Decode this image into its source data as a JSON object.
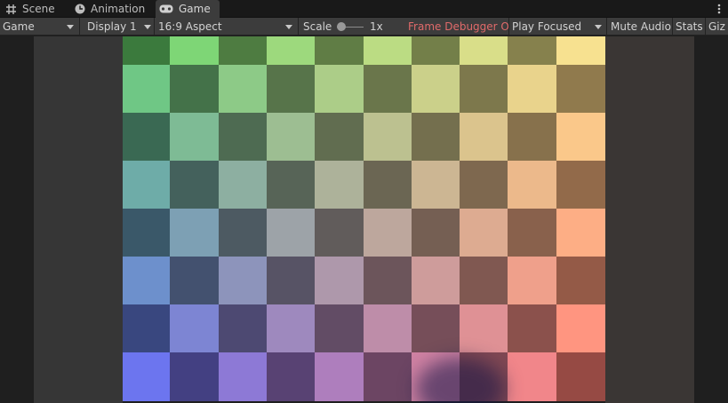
{
  "tabs": {
    "scene": "Scene",
    "animation": "Animation",
    "game": "Game"
  },
  "toolbar": {
    "view_mode": "Game",
    "display": "Display 1",
    "aspect": "16:9 Aspect",
    "scale_label": "Scale",
    "scale_value": "1x",
    "scale_level": 0.0,
    "frame_debugger": "Frame Debugger On",
    "play_mode": "Play Focused",
    "mute_audio": "Mute Audio",
    "stats": "Stats",
    "gizmos": "Giz"
  },
  "colors": {
    "frame_debugger": "#e06a6a",
    "active_tab": "#3c3c3c",
    "toolbar": "#3c3c3c",
    "top_left": "#4fc24f",
    "top_right": "#e5cf7a",
    "bottom_left": "#4a54e6",
    "bottom_right": "#f26a5c"
  },
  "game_view": {
    "scene": "checkerboard",
    "rows": 8,
    "cols": 10
  }
}
